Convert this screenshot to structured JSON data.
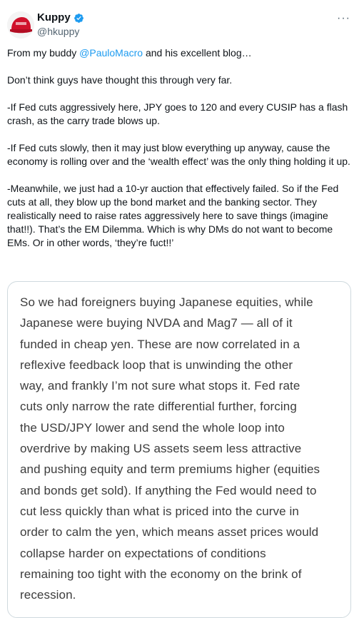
{
  "author": {
    "display_name": "Kuppy",
    "handle": "@hkuppy",
    "avatar_icon": "red-cap-avatar",
    "verified_icon": "verified-badge-icon",
    "verified_color": "#1d9bf0"
  },
  "menu": {
    "more_label": "···"
  },
  "tweet": {
    "p1_pre": "From my buddy ",
    "p1_mention": "@PauloMacro",
    "p1_post": " and his excellent blog…",
    "p2": "Don’t think guys have thought this through very far.",
    "p3": "-If Fed cuts aggressively here, JPY goes to 120 and every CUSIP has a flash crash, as the carry trade blows up.",
    "p4": "-If Fed cuts slowly, then it may just blow everything up anyway, cause the economy is rolling over and the ‘wealth effect’ was the only thing holding it up.",
    "p5": "-Meanwhile, we just had a 10-yr auction that effectively failed. So if the Fed cuts at all, they blow up the bond market and the banking sector. They realistically need to raise rates aggressively here to save things (imagine that!!). That’s the EM Dilemma. Which is why DMs do not want to become EMs. Or in other words, ‘they’re fuct!!’",
    "mention_color": "#1d9bf0"
  },
  "media": {
    "lines": [
      "So we had foreigners buying Japanese equities, while",
      "Japanese were buying NVDA and Mag7 — all of it",
      "funded in cheap yen. These are now correlated in a",
      "reflexive feedback loop that is unwinding the other",
      "way, and frankly I’m not sure what stops it. Fed rate",
      "cuts only narrow the rate differential further, forcing",
      "the USD/JPY lower and send the whole loop into",
      "overdrive by making US assets seem less attractive",
      "and pushing equity and term premiums higher (equities",
      "and bonds get sold). If anything the Fed would need to",
      "cut less quickly than what is priced into the curve in",
      "order to calm the yen, which means asset prices would",
      "collapse harder on expectations of conditions",
      "remaining too tight with the economy on the brink of",
      "recession."
    ]
  }
}
